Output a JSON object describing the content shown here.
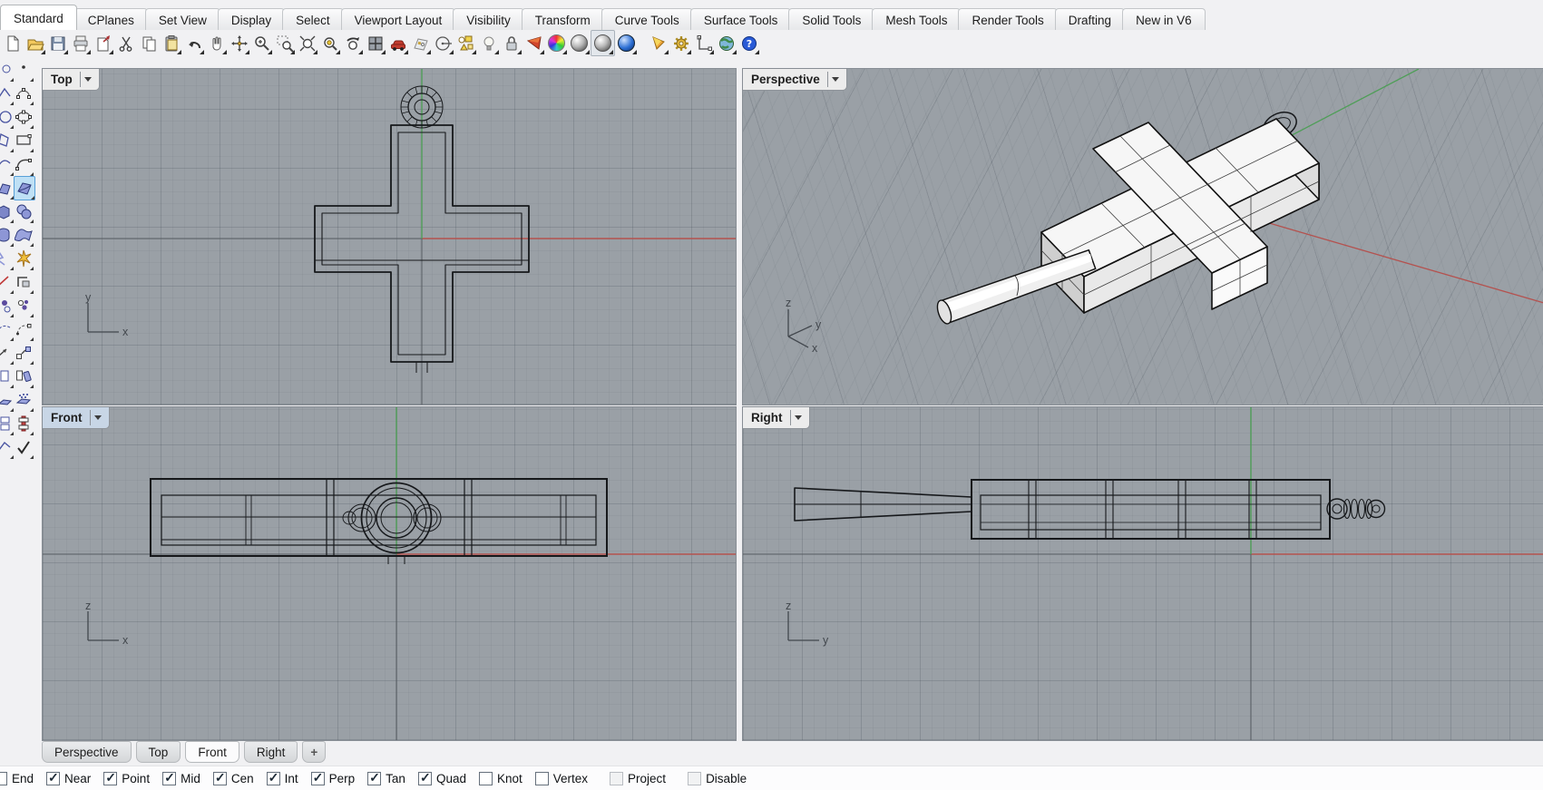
{
  "menu_tabs": [
    {
      "label": "Standard",
      "active": true
    },
    {
      "label": "CPlanes",
      "active": false
    },
    {
      "label": "Set View",
      "active": false
    },
    {
      "label": "Display",
      "active": false
    },
    {
      "label": "Select",
      "active": false
    },
    {
      "label": "Viewport Layout",
      "active": false
    },
    {
      "label": "Visibility",
      "active": false
    },
    {
      "label": "Transform",
      "active": false
    },
    {
      "label": "Curve Tools",
      "active": false
    },
    {
      "label": "Surface Tools",
      "active": false
    },
    {
      "label": "Solid Tools",
      "active": false
    },
    {
      "label": "Mesh Tools",
      "active": false
    },
    {
      "label": "Render Tools",
      "active": false
    },
    {
      "label": "Drafting",
      "active": false
    },
    {
      "label": "New in V6",
      "active": false
    }
  ],
  "toolbar": {
    "icons": [
      "new-file",
      "open-file",
      "save",
      "print",
      "export-page",
      "cut",
      "copy",
      "paste",
      "undo",
      "pan",
      "move",
      "zoom",
      "zoom-window",
      "zoom-extents",
      "zoom-selected",
      "undo-view",
      "viewport-layout",
      "named-views",
      "plan-view",
      "cplane",
      "object-types",
      "lights",
      "lock",
      "render",
      "color-wheel",
      "shaded-display",
      "ghosted-display",
      "rendered-display",
      "notification",
      "options",
      "dimension",
      "web",
      "help"
    ]
  },
  "sidebar": {
    "selected_tool": "surface-corner-points",
    "tools": [
      "point-partial",
      "single-point",
      "polyline-partial",
      "curve-interpolate",
      "circle-partial",
      "ellipse",
      "polygon-partial",
      "rectangle",
      "curve-partial",
      "arc",
      "surface-partial",
      "surface-corner-points",
      "box-partial",
      "sphere",
      "solid-partial",
      "surface-patch",
      "explode-partial",
      "explode",
      "trim-partial",
      "trim",
      "points-partial",
      "point-cloud",
      "rebuild-partial",
      "rebuild-curve",
      "move-partial",
      "copy-to-point",
      "copy-partial",
      "mirror",
      "extrude-partial",
      "extrude-dots",
      "array-partial",
      "array-vertical",
      "group-partial",
      "check-confirm"
    ]
  },
  "viewports": {
    "top": {
      "label": "Top",
      "v_axis": "y",
      "h_axis": "x"
    },
    "perspective": {
      "label": "Perspective",
      "axis_z": "z",
      "axis_y": "y",
      "axis_x": "x"
    },
    "front": {
      "label": "Front",
      "v_axis": "z",
      "h_axis": "x",
      "active": true
    },
    "right": {
      "label": "Right",
      "v_axis": "z",
      "h_axis": "y"
    }
  },
  "viewport_tabs": [
    {
      "label": "Perspective",
      "active": false
    },
    {
      "label": "Top",
      "active": false
    },
    {
      "label": "Front",
      "active": true
    },
    {
      "label": "Right",
      "active": false
    }
  ],
  "viewport_tabs_add": "+",
  "osnap": {
    "items": [
      {
        "label": "End",
        "checked": false,
        "muted": false
      },
      {
        "label": "Near",
        "checked": true,
        "muted": false
      },
      {
        "label": "Point",
        "checked": true,
        "muted": false
      },
      {
        "label": "Mid",
        "checked": true,
        "muted": false
      },
      {
        "label": "Cen",
        "checked": true,
        "muted": false
      },
      {
        "label": "Int",
        "checked": true,
        "muted": false
      },
      {
        "label": "Perp",
        "checked": true,
        "muted": false
      },
      {
        "label": "Tan",
        "checked": true,
        "muted": false
      },
      {
        "label": "Quad",
        "checked": true,
        "muted": false
      },
      {
        "label": "Knot",
        "checked": false,
        "muted": false
      },
      {
        "label": "Vertex",
        "checked": false,
        "muted": false
      },
      {
        "label": "Project",
        "checked": false,
        "muted": true
      },
      {
        "label": "Disable",
        "checked": false,
        "muted": true
      }
    ]
  },
  "colors": {
    "app_bg": "#f1f1f3",
    "viewport_bg": "#9aa0a6",
    "axis_x_red": "#b4524f",
    "axis_y_green": "#4f9e58",
    "axis_dark": "#565b61",
    "wireframe": "#16181b",
    "selection_highlight": "#bfe0f5"
  }
}
